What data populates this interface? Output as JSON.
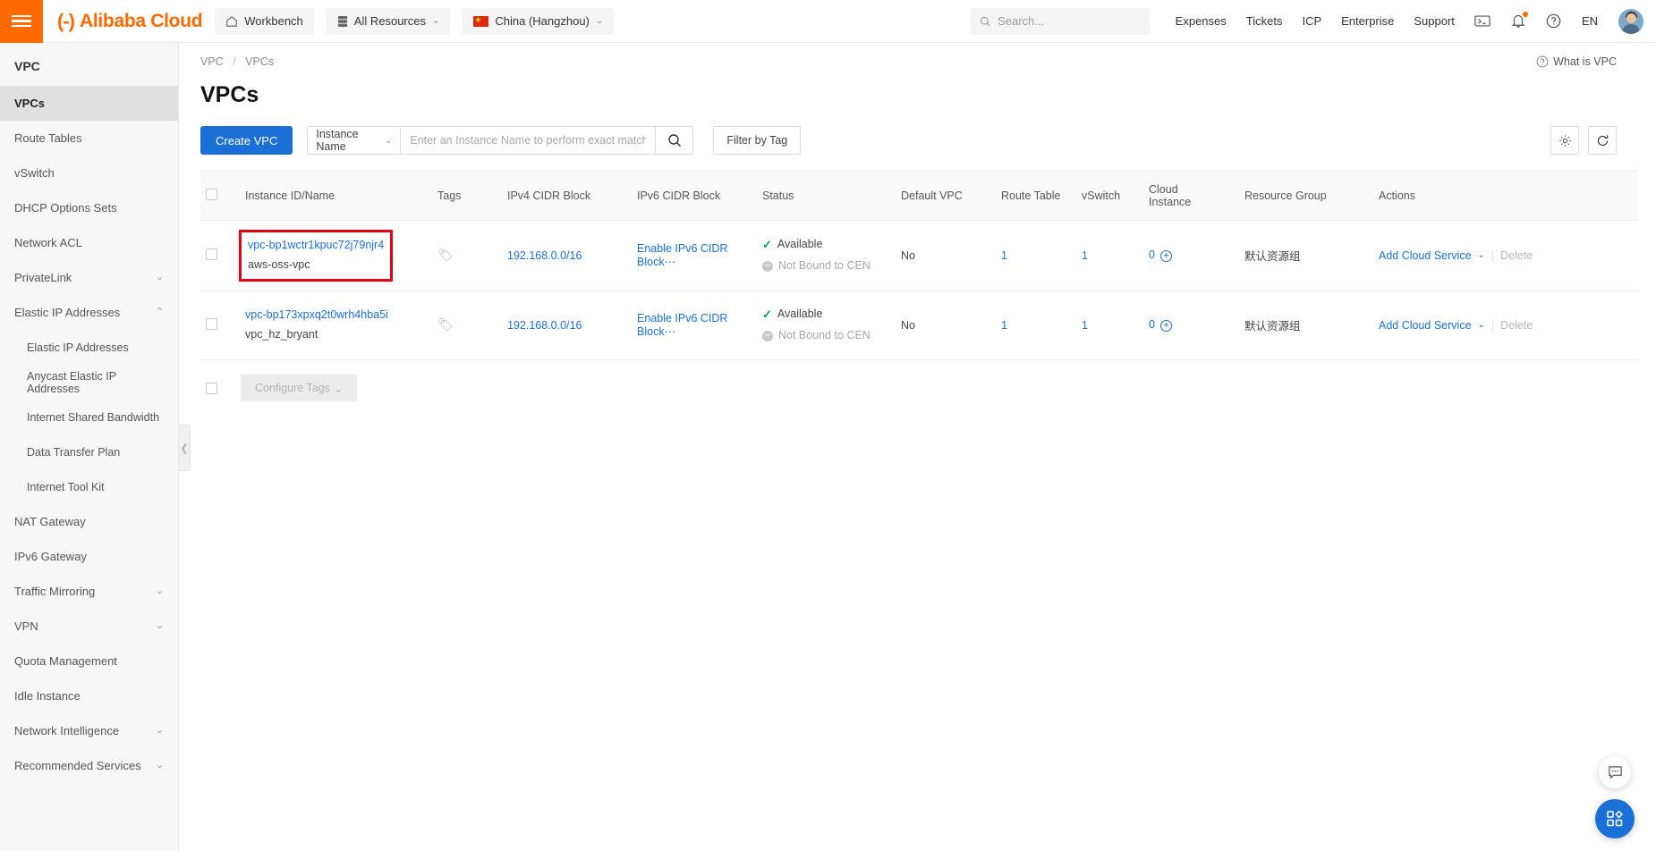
{
  "topbar": {
    "menu_icon": "hamburger-icon",
    "brand": {
      "mark": "(-)",
      "name": "Alibaba Cloud"
    },
    "workbench": "Workbench",
    "all_resources": "All Resources",
    "region": "China (Hangzhou)",
    "caret": "⌄",
    "search": {
      "placeholder": "Search...",
      "value": "",
      "icon": "search-icon"
    },
    "links": [
      "Expenses",
      "Tickets",
      "ICP",
      "Enterprise",
      "Support"
    ],
    "icons": [
      "terminal-icon",
      "bell-icon",
      "help-icon"
    ],
    "language": "EN"
  },
  "sidebar": {
    "title": "VPC",
    "items": [
      {
        "label": "VPCs",
        "active": true,
        "sub": false,
        "chev": ""
      },
      {
        "label": "Route Tables",
        "active": false,
        "sub": false,
        "chev": ""
      },
      {
        "label": "vSwitch",
        "active": false,
        "sub": false,
        "chev": ""
      },
      {
        "label": "DHCP Options Sets",
        "active": false,
        "sub": false,
        "chev": ""
      },
      {
        "label": "Network ACL",
        "active": false,
        "sub": false,
        "chev": ""
      },
      {
        "label": "PrivateLink",
        "active": false,
        "sub": false,
        "chev": "⌄"
      },
      {
        "label": "Elastic IP Addresses",
        "active": false,
        "sub": false,
        "chev": "⌃"
      },
      {
        "label": "Elastic IP Addresses",
        "active": false,
        "sub": true,
        "chev": ""
      },
      {
        "label": "Anycast Elastic IP Addresses",
        "active": false,
        "sub": true,
        "chev": ""
      },
      {
        "label": "Internet Shared Bandwidth",
        "active": false,
        "sub": true,
        "chev": ""
      },
      {
        "label": "Data Transfer Plan",
        "active": false,
        "sub": true,
        "chev": ""
      },
      {
        "label": "Internet Tool Kit",
        "active": false,
        "sub": true,
        "chev": ""
      },
      {
        "label": "NAT Gateway",
        "active": false,
        "sub": false,
        "chev": ""
      },
      {
        "label": "IPv6 Gateway",
        "active": false,
        "sub": false,
        "chev": ""
      },
      {
        "label": "Traffic Mirroring",
        "active": false,
        "sub": false,
        "chev": "⌄"
      },
      {
        "label": "VPN",
        "active": false,
        "sub": false,
        "chev": "⌄"
      },
      {
        "label": "Quota Management",
        "active": false,
        "sub": false,
        "chev": ""
      },
      {
        "label": "Idle Instance",
        "active": false,
        "sub": false,
        "chev": ""
      },
      {
        "label": "Network Intelligence",
        "active": false,
        "sub": false,
        "chev": "⌄"
      },
      {
        "label": "Recommended Services",
        "active": false,
        "sub": false,
        "chev": "⌄"
      }
    ],
    "collapse_icon": "chevron-left-icon"
  },
  "breadcrumb": {
    "root": "VPC",
    "sep": "/",
    "current": "VPCs"
  },
  "help_link": {
    "label": "What is VPC",
    "icon": "help-circle-icon"
  },
  "page_title": "VPCs",
  "toolbar": {
    "create_label": "Create VPC",
    "filter_field": "Instance Name",
    "filter_caret": "⌄",
    "search_placeholder": "Enter an Instance Name to perform exact match",
    "search_value": "",
    "search_icon": "search-icon",
    "filter_by_tag": "Filter by Tag",
    "settings_icon": "gear-icon",
    "refresh_icon": "refresh-icon"
  },
  "table": {
    "columns": [
      "Instance ID/Name",
      "Tags",
      "IPv4 CIDR Block",
      "IPv6 CIDR Block",
      "Status",
      "Default VPC",
      "Route Table",
      "vSwitch",
      "Cloud\nInstance",
      "Resource Group",
      "Actions"
    ],
    "col_cloud_instance_l1": "Cloud",
    "col_cloud_instance_l2": "Instance",
    "rows": [
      {
        "instance_id": "vpc-bp1wctr1kpuc72j79njr4",
        "instance_name": "aws-oss-vpc",
        "highlighted": true,
        "tags_icon": "tag-icon",
        "ipv4": "192.168.0.0/16",
        "ipv6": "Enable IPv6 CIDR Block⋯",
        "status": "Available",
        "cen_status": "Not Bound to CEN",
        "default_vpc": "No",
        "route_table": "1",
        "vswitch": "1",
        "cloud_instance": "0",
        "resource_group": "默认资源组",
        "action_primary": "Add Cloud Service",
        "action_caret": "⌄",
        "action_delete": "Delete"
      },
      {
        "instance_id": "vpc-bp173xpxq2t0wrh4hba5i",
        "instance_name": "vpc_hz_bryant",
        "highlighted": false,
        "tags_icon": "tag-icon",
        "ipv4": "192.168.0.0/16",
        "ipv6": "Enable IPv6 CIDR Block⋯",
        "status": "Available",
        "cen_status": "Not Bound to CEN",
        "default_vpc": "No",
        "route_table": "1",
        "vswitch": "1",
        "cloud_instance": "0",
        "resource_group": "默认资源组",
        "action_primary": "Add Cloud Service",
        "action_caret": "⌄",
        "action_delete": "Delete"
      }
    ]
  },
  "bulk": {
    "configure_tags": "Configure Tags",
    "caret": "⌄"
  },
  "floating": {
    "chat_icon": "chat-bubble-icon",
    "apps_icon": "apps-grid-icon"
  },
  "colors": {
    "brand_orange": "#ff6a00",
    "link_blue": "#1a70d6",
    "highlight_red": "#e60012",
    "status_green": "#00a650"
  }
}
